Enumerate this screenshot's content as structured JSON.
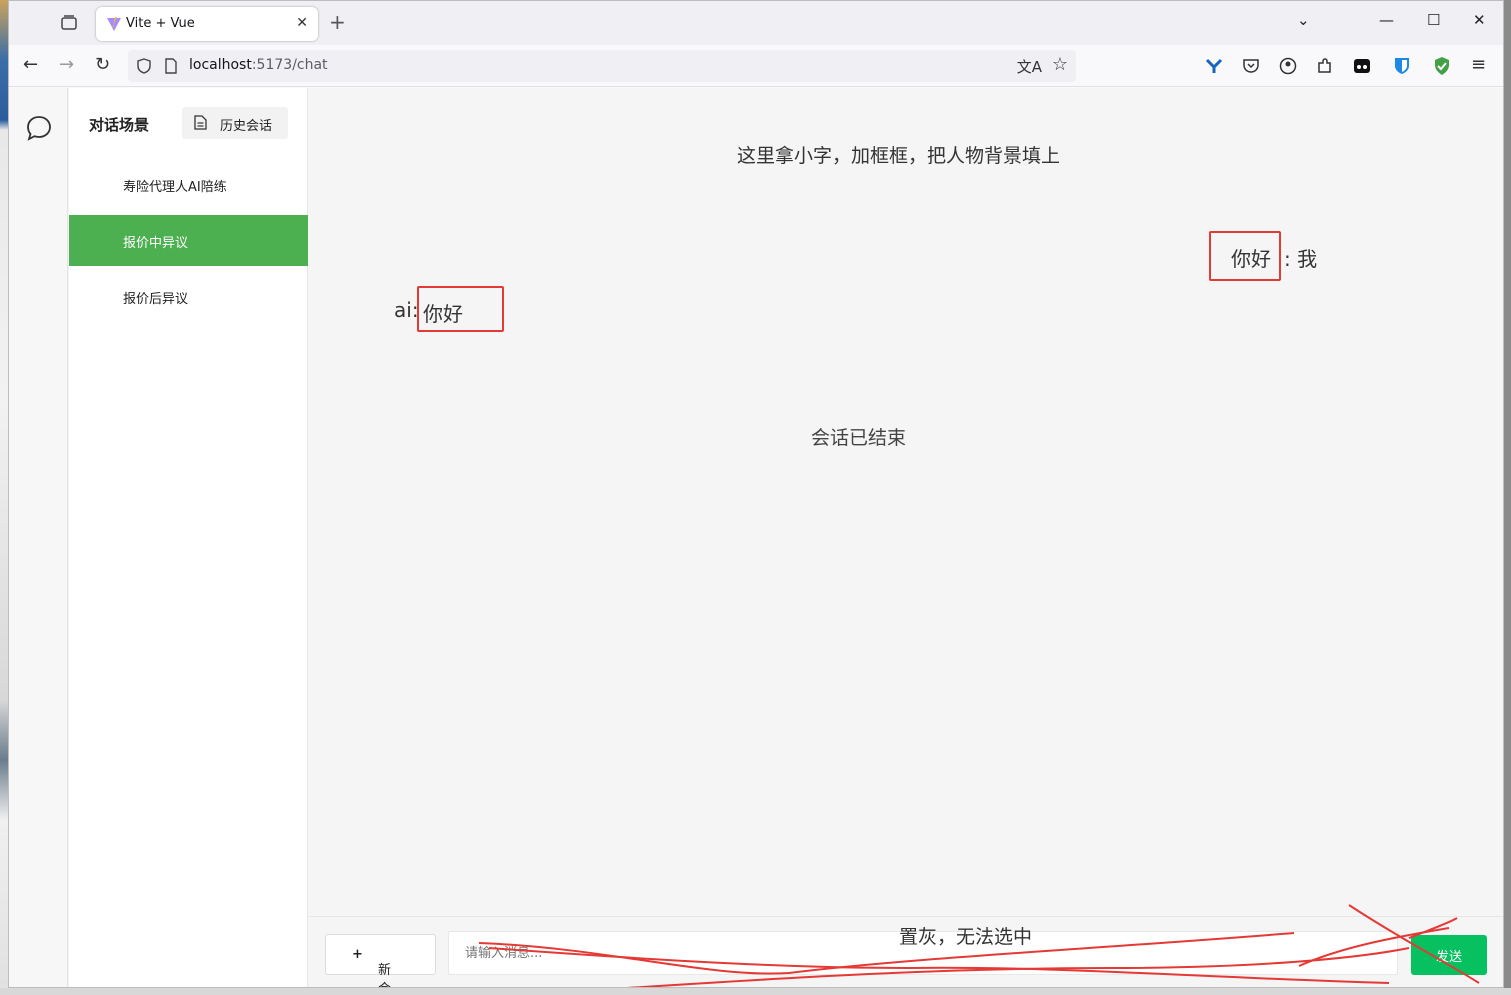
{
  "browser": {
    "tab_title": "Vite + Vue",
    "tab_close": "✕",
    "new_tab": "+",
    "url_host": "localhost",
    "url_rest": ":5173/chat",
    "window_controls": {
      "dropdown": "⌄",
      "minimize": "—",
      "maximize": "☐",
      "close": "✕"
    },
    "nav": {
      "back": "←",
      "forward": "→",
      "reload": "↻",
      "menu": "≡"
    },
    "translate_icon": "文A",
    "bookmark_icon": "☆"
  },
  "sidebar": {
    "heading": "对话场景",
    "history_button": "历史会话",
    "scenes": [
      {
        "label": "寿险代理人AI陪练",
        "active": false
      },
      {
        "label": "报价中异议",
        "active": true
      },
      {
        "label": "报价后异议",
        "active": false
      }
    ]
  },
  "chat": {
    "hint": "这里拿小字，加框框，把人物背景填上",
    "user_message": "你好",
    "user_label": ":  我",
    "ai_label": "ai:",
    "ai_message": "你好",
    "ended_notice": "会话已结束"
  },
  "composer": {
    "new_chat_icon": "+",
    "new_chat_label": "新会话",
    "placeholder": "请输入消息...",
    "send_label": "发送",
    "annotation": "置灰，无法选中"
  },
  "colors": {
    "active_scene": "#4caf50",
    "send_button": "#07c160",
    "annotation_red": "#e53935"
  }
}
